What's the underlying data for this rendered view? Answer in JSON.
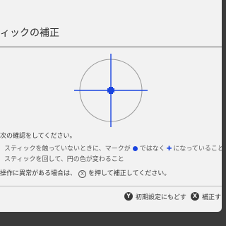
{
  "header": {
    "title": "ィックの補正"
  },
  "instructions": {
    "intro": "次の確認をしてください。",
    "check1_part1": "スティックを触っていないときに、マークが",
    "check1_part2": "ではなく",
    "check1_part3": "になっていること",
    "check2": "スティックを回して、円の色が変わること",
    "action_part1": "操作に異常がある場合は、",
    "action_button_glyph": "X",
    "action_part2": "を押して補正してください。"
  },
  "footer": {
    "reset_icon": "Y",
    "reset_label": "初期設定にもどす",
    "calibrate_icon": "X",
    "calibrate_label": "補正する"
  },
  "colors": {
    "accent": "#1a44e0",
    "circle": "#9a9a9a",
    "background": "#f2f2f2"
  },
  "icons": {
    "stick_state_neutral": "blue-dot-icon",
    "stick_state_target": "blue-plus-icon"
  }
}
